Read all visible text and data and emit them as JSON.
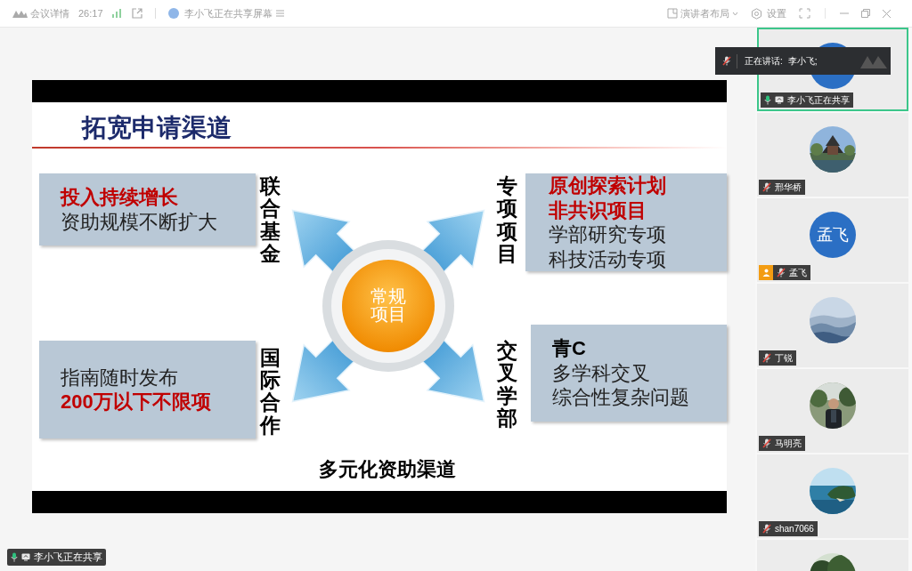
{
  "titlebar": {
    "meeting_info": "会议详情",
    "duration": "26:17",
    "sharing_status": "李小飞正在共享屏幕",
    "layout": "演讲者布局",
    "settings": "设置"
  },
  "slide": {
    "title": "拓宽申请渠道",
    "boxes": [
      {
        "lines": [
          {
            "text": "投入持续增长",
            "kind": "highlight"
          },
          {
            "text": "资助规模不断扩大",
            "kind": "plain"
          }
        ]
      },
      {
        "lines": [
          {
            "text": "指南随时发布",
            "kind": "plain"
          },
          {
            "text": "200万以下不限项",
            "kind": "highlight"
          }
        ]
      },
      {
        "lines": [
          {
            "text": "原创探索计划",
            "kind": "highlight"
          },
          {
            "text": "非共识项目",
            "kind": "highlight"
          },
          {
            "text": "学部研究专项",
            "kind": "plain"
          },
          {
            "text": "科技活动专项",
            "kind": "plain"
          }
        ]
      },
      {
        "lines": [
          {
            "text": "青C",
            "kind": "heading"
          },
          {
            "text": "多学科交叉",
            "kind": "plain"
          },
          {
            "text": "综合性复杂问题",
            "kind": "plain"
          }
        ]
      }
    ],
    "side_labels": [
      "联合基金",
      "国际合作",
      "专项项目",
      "交叉学部"
    ],
    "hub_label": [
      "常规",
      "项目"
    ],
    "footer": "多元化资助渠道"
  },
  "speaking": {
    "label": "正在讲话:",
    "name": "李小飞;"
  },
  "participants": [
    {
      "name": "李小飞正在共享",
      "avatar": {
        "kind": "plain"
      },
      "muted": false,
      "sharing": true,
      "host": false,
      "selected": true
    },
    {
      "name": "邢华桥",
      "muted": true,
      "sharing": false,
      "host": false,
      "selected": false
    },
    {
      "name": "孟飞",
      "avatar": {
        "kind": "initials",
        "text": "孟飞"
      },
      "muted": true,
      "sharing": false,
      "host": true,
      "selected": false
    },
    {
      "name": "丁锐",
      "muted": true,
      "sharing": false,
      "host": false,
      "selected": false
    },
    {
      "name": "马明亮",
      "muted": true,
      "sharing": false,
      "host": false,
      "selected": false
    },
    {
      "name": "shan7066",
      "muted": true,
      "sharing": false,
      "host": false,
      "selected": false
    },
    {
      "selected": false
    }
  ],
  "share_badge": {
    "text": "李小飞正在共享",
    "muted": false,
    "sharing": true
  }
}
